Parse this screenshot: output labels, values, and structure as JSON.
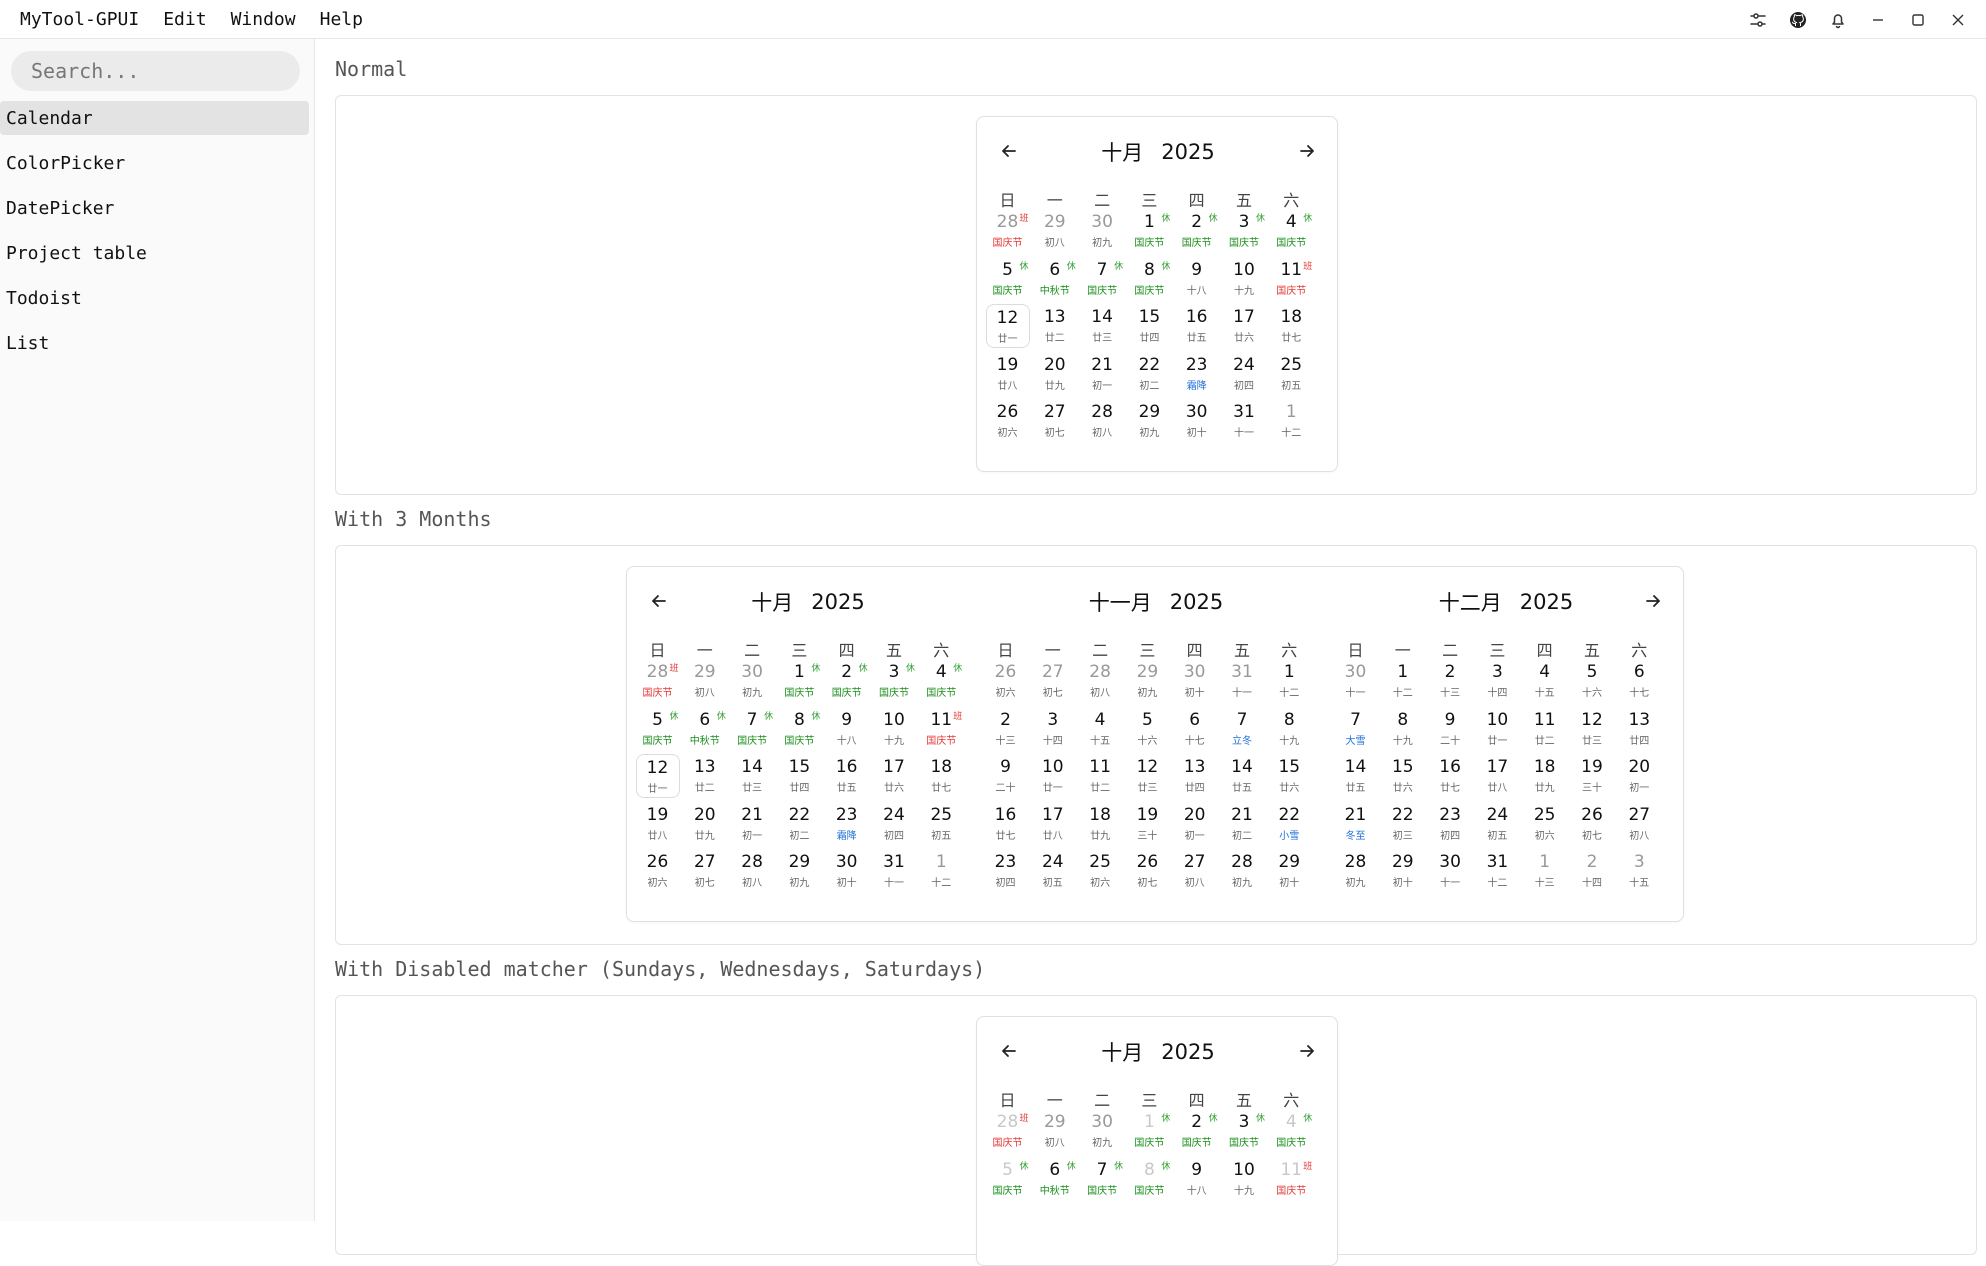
{
  "app": {
    "title": "MyTool-GPUI",
    "menus": [
      "Edit",
      "Window",
      "Help"
    ],
    "toolbar_icons": [
      "settings-sliders-icon",
      "github-icon",
      "bell-icon",
      "minimize-icon",
      "maximize-icon",
      "close-icon"
    ]
  },
  "sidebar": {
    "search_placeholder": "Search...",
    "items": [
      {
        "label": "Calendar",
        "active": true
      },
      {
        "label": "ColorPicker",
        "active": false
      },
      {
        "label": "DatePicker",
        "active": false
      },
      {
        "label": "Project table",
        "active": false
      },
      {
        "label": "Todoist",
        "active": false
      },
      {
        "label": "List",
        "active": false
      }
    ]
  },
  "weekdays": [
    "日",
    "一",
    "二",
    "三",
    "四",
    "五",
    "六"
  ],
  "colors": {
    "rest_badge": "#2e9e2e",
    "work_badge": "#e53935",
    "holiday_green": "#1b8f1b",
    "holiday_red": "#e53935",
    "solar_term_blue": "#1e6fd9"
  },
  "sections": [
    {
      "title": "Normal"
    },
    {
      "title": "With 3 Months"
    },
    {
      "title": "With Disabled matcher (Sundays, Wednesdays, Saturdays)"
    }
  ],
  "months": {
    "oct": {
      "label": "十月",
      "year": "2025",
      "days": [
        {
          "n": "28",
          "l": "国庆节",
          "lc": "red",
          "b": "班",
          "bc": "work",
          "out": true
        },
        {
          "n": "29",
          "l": "初八",
          "out": true
        },
        {
          "n": "30",
          "l": "初九",
          "out": true
        },
        {
          "n": "1",
          "l": "国庆节",
          "lc": "green",
          "b": "休",
          "bc": "rest"
        },
        {
          "n": "2",
          "l": "国庆节",
          "lc": "green",
          "b": "休",
          "bc": "rest"
        },
        {
          "n": "3",
          "l": "国庆节",
          "lc": "green",
          "b": "休",
          "bc": "rest"
        },
        {
          "n": "4",
          "l": "国庆节",
          "lc": "green",
          "b": "休",
          "bc": "rest"
        },
        {
          "n": "5",
          "l": "国庆节",
          "lc": "green",
          "b": "休",
          "bc": "rest"
        },
        {
          "n": "6",
          "l": "中秋节",
          "lc": "green",
          "b": "休",
          "bc": "rest"
        },
        {
          "n": "7",
          "l": "国庆节",
          "lc": "green",
          "b": "休",
          "bc": "rest"
        },
        {
          "n": "8",
          "l": "国庆节",
          "lc": "green",
          "b": "休",
          "bc": "rest"
        },
        {
          "n": "9",
          "l": "十八"
        },
        {
          "n": "10",
          "l": "十九"
        },
        {
          "n": "11",
          "l": "国庆节",
          "lc": "red",
          "b": "班",
          "bc": "work"
        },
        {
          "n": "12",
          "l": "廿一",
          "today": true
        },
        {
          "n": "13",
          "l": "廿二"
        },
        {
          "n": "14",
          "l": "廿三"
        },
        {
          "n": "15",
          "l": "廿四"
        },
        {
          "n": "16",
          "l": "廿五"
        },
        {
          "n": "17",
          "l": "廿六"
        },
        {
          "n": "18",
          "l": "廿七"
        },
        {
          "n": "19",
          "l": "廿八"
        },
        {
          "n": "20",
          "l": "廿九"
        },
        {
          "n": "21",
          "l": "初一"
        },
        {
          "n": "22",
          "l": "初二"
        },
        {
          "n": "23",
          "l": "霜降",
          "lc": "blue"
        },
        {
          "n": "24",
          "l": "初四"
        },
        {
          "n": "25",
          "l": "初五"
        },
        {
          "n": "26",
          "l": "初六"
        },
        {
          "n": "27",
          "l": "初七"
        },
        {
          "n": "28",
          "l": "初八"
        },
        {
          "n": "29",
          "l": "初九"
        },
        {
          "n": "30",
          "l": "初十"
        },
        {
          "n": "31",
          "l": "十一"
        },
        {
          "n": "1",
          "l": "十二",
          "out": true
        }
      ]
    },
    "nov": {
      "label": "十一月",
      "year": "2025",
      "days": [
        {
          "n": "26",
          "l": "初六",
          "out": true
        },
        {
          "n": "27",
          "l": "初七",
          "out": true
        },
        {
          "n": "28",
          "l": "初八",
          "out": true
        },
        {
          "n": "29",
          "l": "初九",
          "out": true
        },
        {
          "n": "30",
          "l": "初十",
          "out": true
        },
        {
          "n": "31",
          "l": "十一",
          "out": true
        },
        {
          "n": "1",
          "l": "十二"
        },
        {
          "n": "2",
          "l": "十三"
        },
        {
          "n": "3",
          "l": "十四"
        },
        {
          "n": "4",
          "l": "十五"
        },
        {
          "n": "5",
          "l": "十六"
        },
        {
          "n": "6",
          "l": "十七"
        },
        {
          "n": "7",
          "l": "立冬",
          "lc": "blue"
        },
        {
          "n": "8",
          "l": "十九"
        },
        {
          "n": "9",
          "l": "二十"
        },
        {
          "n": "10",
          "l": "廿一"
        },
        {
          "n": "11",
          "l": "廿二"
        },
        {
          "n": "12",
          "l": "廿三"
        },
        {
          "n": "13",
          "l": "廿四"
        },
        {
          "n": "14",
          "l": "廿五"
        },
        {
          "n": "15",
          "l": "廿六"
        },
        {
          "n": "16",
          "l": "廿七"
        },
        {
          "n": "17",
          "l": "廿八"
        },
        {
          "n": "18",
          "l": "廿九"
        },
        {
          "n": "19",
          "l": "三十"
        },
        {
          "n": "20",
          "l": "初一"
        },
        {
          "n": "21",
          "l": "初二"
        },
        {
          "n": "22",
          "l": "小雪",
          "lc": "blue"
        },
        {
          "n": "23",
          "l": "初四"
        },
        {
          "n": "24",
          "l": "初五"
        },
        {
          "n": "25",
          "l": "初六"
        },
        {
          "n": "26",
          "l": "初七"
        },
        {
          "n": "27",
          "l": "初八"
        },
        {
          "n": "28",
          "l": "初九"
        },
        {
          "n": "29",
          "l": "初十"
        }
      ]
    },
    "dec": {
      "label": "十二月",
      "year": "2025",
      "days": [
        {
          "n": "30",
          "l": "十一",
          "out": true
        },
        {
          "n": "1",
          "l": "十二"
        },
        {
          "n": "2",
          "l": "十三"
        },
        {
          "n": "3",
          "l": "十四"
        },
        {
          "n": "4",
          "l": "十五"
        },
        {
          "n": "5",
          "l": "十六"
        },
        {
          "n": "6",
          "l": "十七"
        },
        {
          "n": "7",
          "l": "大雪",
          "lc": "blue"
        },
        {
          "n": "8",
          "l": "十九"
        },
        {
          "n": "9",
          "l": "二十"
        },
        {
          "n": "10",
          "l": "廿一"
        },
        {
          "n": "11",
          "l": "廿二"
        },
        {
          "n": "12",
          "l": "廿三"
        },
        {
          "n": "13",
          "l": "廿四"
        },
        {
          "n": "14",
          "l": "廿五"
        },
        {
          "n": "15",
          "l": "廿六"
        },
        {
          "n": "16",
          "l": "廿七"
        },
        {
          "n": "17",
          "l": "廿八"
        },
        {
          "n": "18",
          "l": "廿九"
        },
        {
          "n": "19",
          "l": "三十"
        },
        {
          "n": "20",
          "l": "初一"
        },
        {
          "n": "21",
          "l": "冬至",
          "lc": "blue"
        },
        {
          "n": "22",
          "l": "初三"
        },
        {
          "n": "23",
          "l": "初四"
        },
        {
          "n": "24",
          "l": "初五"
        },
        {
          "n": "25",
          "l": "初六"
        },
        {
          "n": "26",
          "l": "初七"
        },
        {
          "n": "27",
          "l": "初八"
        },
        {
          "n": "28",
          "l": "初九"
        },
        {
          "n": "29",
          "l": "初十"
        },
        {
          "n": "30",
          "l": "十一"
        },
        {
          "n": "31",
          "l": "十二"
        },
        {
          "n": "1",
          "l": "十三",
          "out": true
        },
        {
          "n": "2",
          "l": "十四",
          "out": true
        },
        {
          "n": "3",
          "l": "十五",
          "out": true
        }
      ]
    },
    "oct_disabled": {
      "label": "十月",
      "year": "2025",
      "days": [
        {
          "n": "28",
          "l": "国庆节",
          "lc": "red",
          "b": "班",
          "bc": "work",
          "dis": true
        },
        {
          "n": "29",
          "l": "初八",
          "out": true
        },
        {
          "n": "30",
          "l": "初九",
          "out": true
        },
        {
          "n": "1",
          "l": "国庆节",
          "lc": "green",
          "b": "休",
          "bc": "rest",
          "dis": true
        },
        {
          "n": "2",
          "l": "国庆节",
          "lc": "green",
          "b": "休",
          "bc": "rest"
        },
        {
          "n": "3",
          "l": "国庆节",
          "lc": "green",
          "b": "休",
          "bc": "rest"
        },
        {
          "n": "4",
          "l": "国庆节",
          "lc": "green",
          "b": "休",
          "bc": "rest",
          "dis": true
        },
        {
          "n": "5",
          "l": "国庆节",
          "lc": "green",
          "b": "休",
          "bc": "rest",
          "dis": true
        },
        {
          "n": "6",
          "l": "中秋节",
          "lc": "green",
          "b": "休",
          "bc": "rest"
        },
        {
          "n": "7",
          "l": "国庆节",
          "lc": "green",
          "b": "休",
          "bc": "rest"
        },
        {
          "n": "8",
          "l": "国庆节",
          "lc": "green",
          "b": "休",
          "bc": "rest",
          "dis": true
        },
        {
          "n": "9",
          "l": "十八"
        },
        {
          "n": "10",
          "l": "十九"
        },
        {
          "n": "11",
          "l": "国庆节",
          "lc": "red",
          "b": "班",
          "bc": "work",
          "dis": true
        }
      ]
    }
  }
}
